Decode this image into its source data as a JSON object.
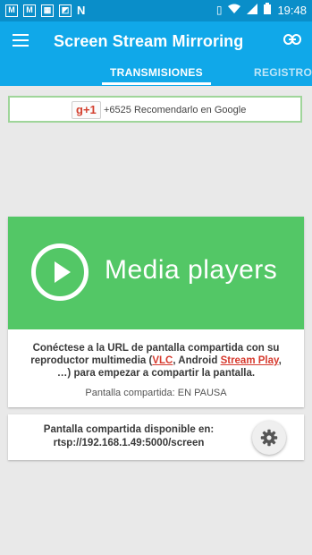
{
  "statusbar": {
    "left_icons": [
      "gmail-icon",
      "gmail-icon",
      "photo-icon",
      "app-icon",
      "n-app-icon"
    ],
    "time": "19:48"
  },
  "appbar": {
    "title": "Screen Stream Mirroring",
    "tabs": [
      {
        "label": "TRANSMISIONES",
        "active": true
      },
      {
        "label": "REGISTROS",
        "active": false
      }
    ]
  },
  "gplus": {
    "badge": "g+1",
    "text": "+6525 Recomendarlo en Google"
  },
  "media_card": {
    "banner_title": "Media players",
    "instruction_part1": "Conéctese a la URL de pantalla compartida con su reproductor multimedia (",
    "link_vlc": "VLC",
    "instruction_part2": ", Android ",
    "link_streamplay": "Stream Play",
    "instruction_part3": ", …) para empezar a compartir la pantalla.",
    "status": "Pantalla compartida: EN PAUSA"
  },
  "stream_card": {
    "line1": "Pantalla compartida disponible en:",
    "url": "rtsp://192.168.1.49:5000/screen"
  },
  "colors": {
    "statusbar": "#0a8ec9",
    "appbar": "#10a8e9",
    "banner": "#53c766",
    "link": "#d63a2e"
  }
}
